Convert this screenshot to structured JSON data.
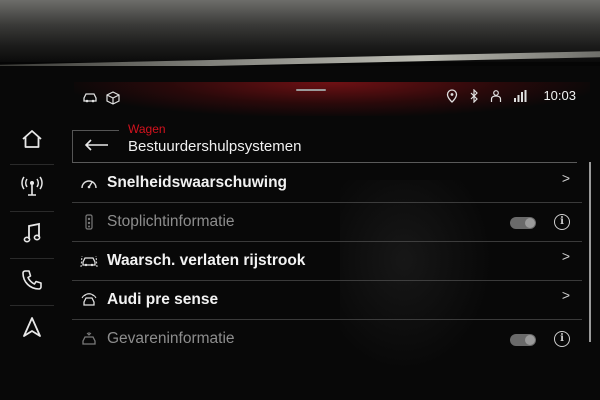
{
  "status_bar": {
    "left_icons": [
      "car-status-icon",
      "package-icon"
    ],
    "right_icons": [
      "location-icon",
      "bluetooth-icon",
      "person-icon",
      "lte-signal-icon"
    ],
    "time": "10:03"
  },
  "side_nav": [
    {
      "name": "home",
      "icon": "home-icon"
    },
    {
      "name": "radio",
      "icon": "antenna-icon"
    },
    {
      "name": "media",
      "icon": "music-note-icon"
    },
    {
      "name": "phone",
      "icon": "phone-icon"
    },
    {
      "name": "navigation",
      "icon": "navigation-arrow-icon"
    }
  ],
  "header": {
    "breadcrumb": "Wagen",
    "title": "Bestuurdershulpsystemen"
  },
  "list": [
    {
      "label": "Snelheidswaarschuwing",
      "icon": "speedometer-icon",
      "enabled": true,
      "control": "chevron",
      "chevron": ">"
    },
    {
      "label": "Stoplichtinformatie",
      "icon": "traffic-light-icon",
      "enabled": false,
      "control": "toggle",
      "info": "i"
    },
    {
      "label": "Waarsch. verlaten rijstrook",
      "icon": "lane-departure-icon",
      "enabled": true,
      "control": "chevron",
      "chevron": ">"
    },
    {
      "label": "Audi pre sense",
      "icon": "pre-sense-icon",
      "enabled": true,
      "control": "chevron",
      "chevron": ">"
    },
    {
      "label": "Gevareninformatie",
      "icon": "hazard-info-icon",
      "enabled": false,
      "control": "toggle",
      "info": "i"
    }
  ],
  "colors": {
    "accent_red": "#d4121e",
    "text_primary": "#f2f2f2",
    "text_disabled": "#8d8d8d"
  }
}
